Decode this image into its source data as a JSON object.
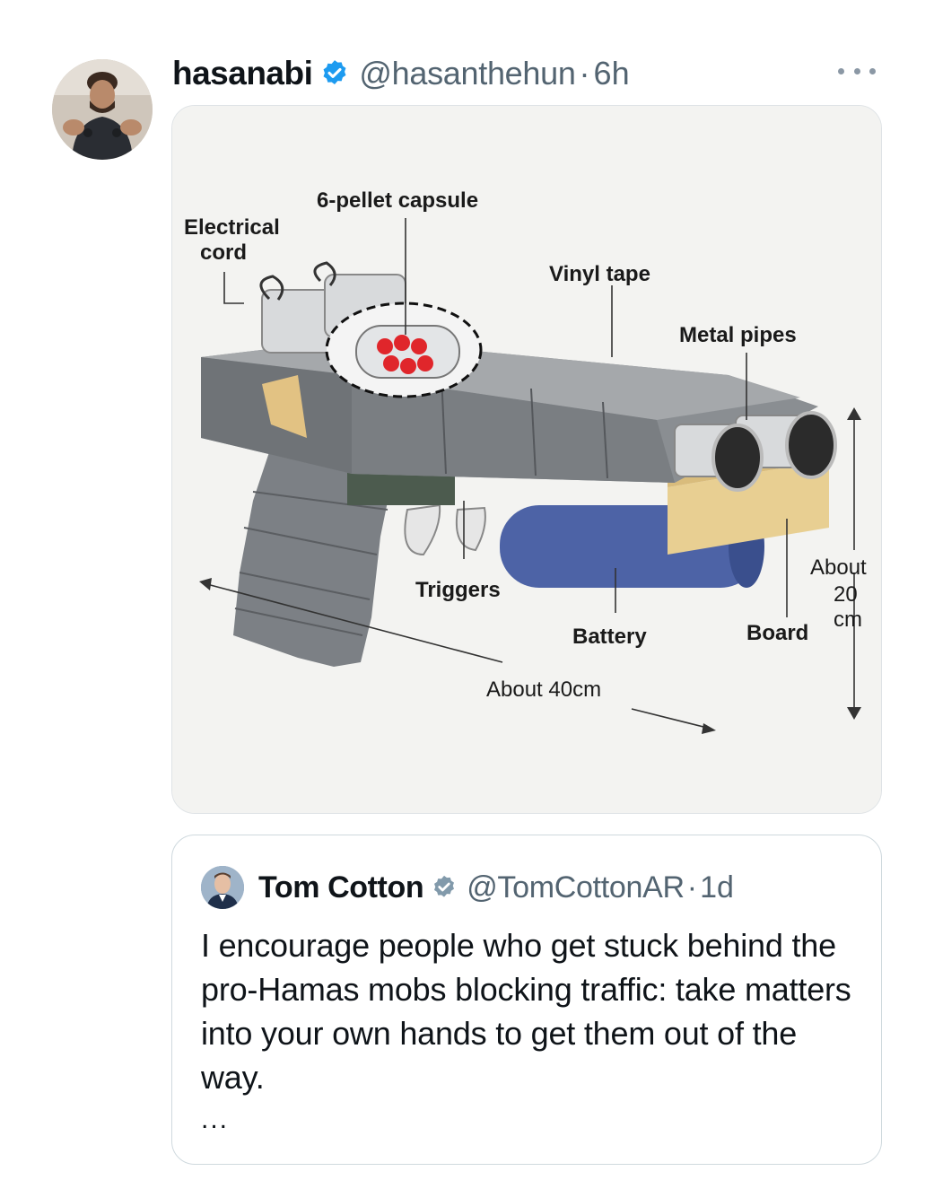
{
  "tweet": {
    "author_name": "hasanabi",
    "author_handle": "@hasanthehun",
    "separator": "·",
    "time": "6h",
    "verified": true,
    "more_icon": "more-horizontal-icon"
  },
  "diagram": {
    "label_electrical_cord_line1": "Electrical",
    "label_electrical_cord_line2": "cord",
    "label_capsule": "6-pellet capsule",
    "label_vinyl_tape": "Vinyl tape",
    "label_metal_pipes": "Metal pipes",
    "label_triggers": "Triggers",
    "label_battery": "Battery",
    "label_board": "Board",
    "label_height_line1": "About",
    "label_height_line2": "20",
    "label_height_line3": "cm",
    "label_length": "About 40cm",
    "colors": {
      "tape": "#7f8387",
      "board": "#e8cf92",
      "battery": "#4d63a6",
      "pellet": "#e0262b",
      "pipe": "#d8dadc"
    }
  },
  "quoted_tweet": {
    "author_name": "Tom Cotton",
    "author_handle": "@TomCottonAR",
    "separator": "·",
    "time": "1d",
    "verified": true,
    "text": "I encourage people who get stuck behind the pro-Hamas mobs blocking traffic: take matters into your own hands to get them out of the way.",
    "ellipsis": "..."
  },
  "badge_color": "#1d9bf0",
  "quoted_badge_color": "#829aab"
}
